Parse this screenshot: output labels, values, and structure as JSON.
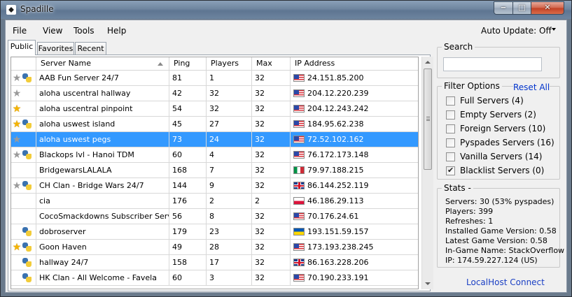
{
  "window": {
    "title": "Spadille"
  },
  "titlebar": {
    "minimize": "‒",
    "maximize": "□",
    "close": "✕"
  },
  "menu": {
    "file": "File",
    "view": "View",
    "tools": "Tools",
    "help": "Help",
    "auto_update": "Auto Update: Off"
  },
  "tabs": [
    {
      "label": "Public"
    },
    {
      "label": "Favorites"
    },
    {
      "label": "Recent"
    }
  ],
  "grid": {
    "columns": [
      "Server Name",
      "Ping",
      "Players",
      "Max",
      "IP Address"
    ],
    "rows": [
      {
        "name": "AAB Fun Server 24/7",
        "ping": "81",
        "players": "1",
        "max": "32",
        "ip": "24.151.85.200",
        "flag": "us",
        "star": "gray",
        "pyspades": true
      },
      {
        "name": "aloha uscentral hallway",
        "ping": "42",
        "players": "32",
        "max": "32",
        "ip": "204.12.220.239",
        "flag": "us",
        "star": "gray",
        "pyspades": false
      },
      {
        "name": "aloha uscentral pinpoint",
        "ping": "54",
        "players": "32",
        "max": "32",
        "ip": "204.12.243.242",
        "flag": "us",
        "star": "gold",
        "pyspades": false
      },
      {
        "name": "aloha uswest island",
        "ping": "45",
        "players": "27",
        "max": "32",
        "ip": "184.95.62.238",
        "flag": "us",
        "star": "gold",
        "pyspades": true
      },
      {
        "name": "aloha uswest pegs",
        "ping": "73",
        "players": "24",
        "max": "32",
        "ip": "72.52.102.162",
        "flag": "us",
        "star": "gray",
        "pyspades": false,
        "selected": true
      },
      {
        "name": "Blackops lvl - Hanoi TDM",
        "ping": "60",
        "players": "4",
        "max": "32",
        "ip": "76.172.173.148",
        "flag": "us",
        "star": "gray",
        "pyspades": true
      },
      {
        "name": "BridgewarsLALALA",
        "ping": "168",
        "players": "7",
        "max": "32",
        "ip": "79.97.188.215",
        "flag": "it",
        "star": "none",
        "pyspades": false
      },
      {
        "name": "CH Clan - Bridge Wars 24/7",
        "ping": "144",
        "players": "9",
        "max": "32",
        "ip": "86.144.252.119",
        "flag": "gb",
        "star": "gray",
        "pyspades": true
      },
      {
        "name": "cia",
        "ping": "176",
        "players": "2",
        "max": "2",
        "ip": "46.186.29.113",
        "flag": "pl",
        "star": "none",
        "pyspades": false
      },
      {
        "name": "CocoSmackdowns Subscriber Serve",
        "ping": "56",
        "players": "8",
        "max": "32",
        "ip": "70.176.24.61",
        "flag": "us",
        "star": "none",
        "pyspades": false
      },
      {
        "name": "dobroserver",
        "ping": "179",
        "players": "23",
        "max": "32",
        "ip": "193.151.59.157",
        "flag": "ua",
        "star": "none",
        "pyspades": true
      },
      {
        "name": "Goon Haven",
        "ping": "49",
        "players": "28",
        "max": "32",
        "ip": "173.193.238.245",
        "flag": "us",
        "star": "gold",
        "pyspades": true
      },
      {
        "name": "hallway 24/7",
        "ping": "158",
        "players": "17",
        "max": "32",
        "ip": "86.163.228.206",
        "flag": "gb",
        "star": "none",
        "pyspades": true
      },
      {
        "name": "HK Clan - All Welcome - Favela",
        "ping": "60",
        "players": "3",
        "max": "32",
        "ip": "70.190.233.191",
        "flag": "us",
        "star": "none",
        "pyspades": true
      }
    ]
  },
  "search": {
    "title": "Search",
    "value": ""
  },
  "filters": {
    "title": "Filter Options",
    "reset": "Reset All",
    "items": [
      {
        "label": "Full Servers (4)",
        "checked": false
      },
      {
        "label": "Empty Servers (2)",
        "checked": false
      },
      {
        "label": "Foreign Servers (10)",
        "checked": false
      },
      {
        "label": "Pyspades Servers (16)",
        "checked": false
      },
      {
        "label": "Vanilla Servers (14)",
        "checked": false
      },
      {
        "label": "Blacklist Servers (0)",
        "checked": true
      }
    ]
  },
  "stats": {
    "title": "Stats -",
    "lines": [
      "Servers: 30 (53% pyspades)",
      "Players: 399",
      "Refreshes: 1",
      "Installed Game Version: 0.58",
      "Latest Game Version: 0.58",
      "In-Game Name: StackOverflow",
      "IP: 174.59.227.124 (US)"
    ]
  },
  "footer": {
    "localhost": "LocalHost Connect"
  }
}
